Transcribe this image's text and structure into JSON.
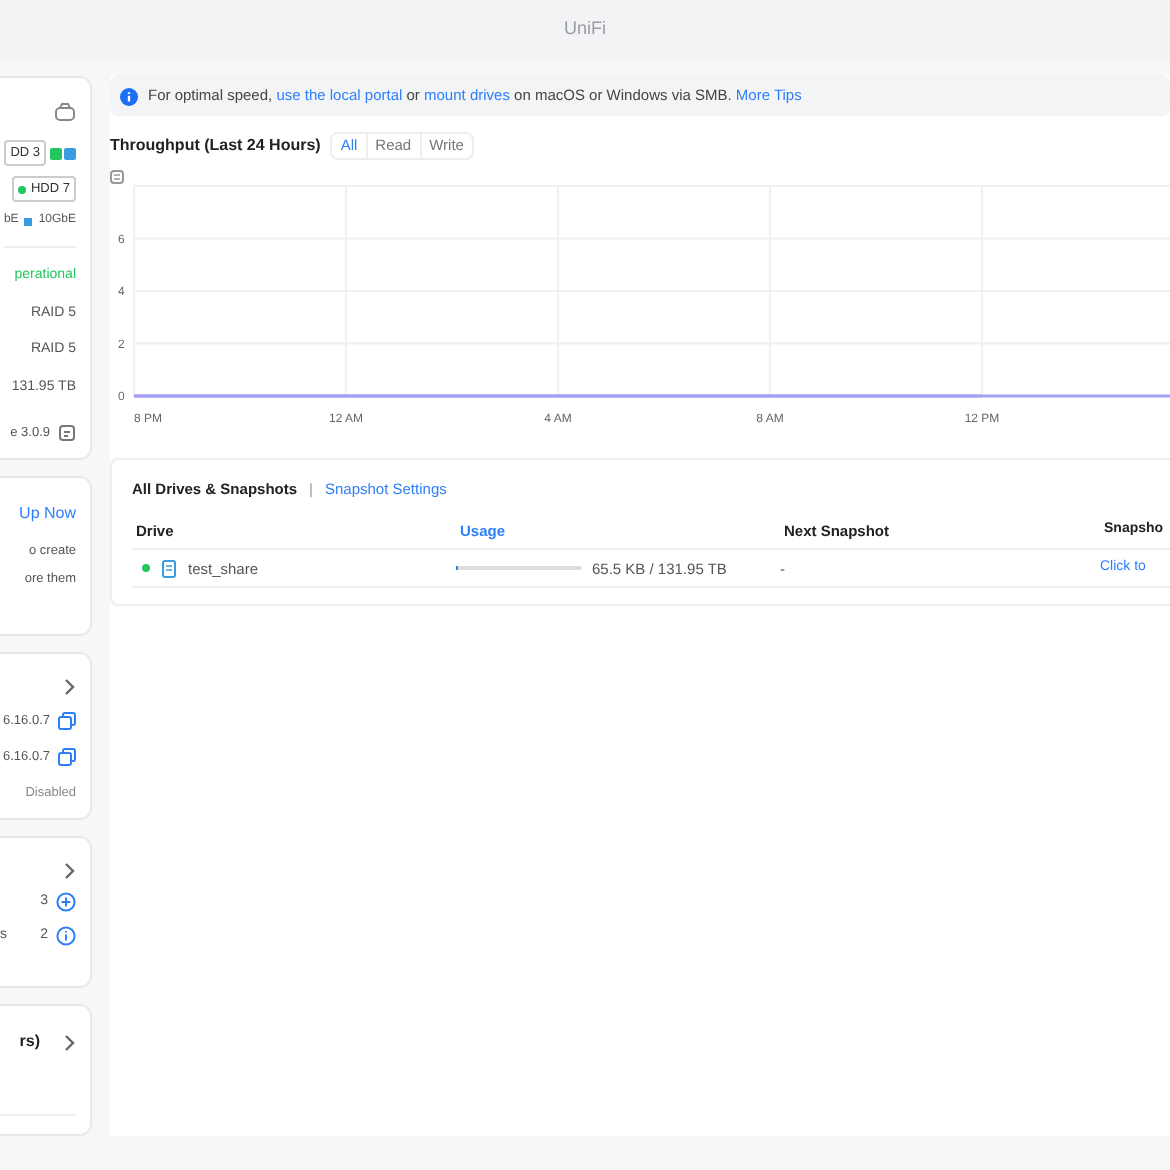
{
  "window": {
    "title": "UniFi"
  },
  "side_cards": [
    {
      "kind": "storage",
      "rows": [
        {
          "kind": "bay",
          "label": "DD 3",
          "dot": false,
          "ports": true
        },
        {
          "kind": "bay",
          "label": "HDD 7",
          "dot": true,
          "ports": false
        },
        {
          "kind": "legend",
          "items": [
            {
              "label": "bE"
            },
            {
              "label": "10GbE",
              "color": "#3b9be0"
            }
          ]
        },
        {
          "kind": "status",
          "text": "perational"
        },
        {
          "kind": "text",
          "text": "RAID 5"
        },
        {
          "kind": "text",
          "text": "RAID 5"
        },
        {
          "kind": "text",
          "text": "131.95 TB"
        },
        {
          "kind": "version",
          "text": "e 3.0.9"
        }
      ]
    },
    {
      "kind": "backup",
      "link": "Up Now",
      "lines": [
        "o create",
        "ore them"
      ]
    },
    {
      "kind": "network",
      "rows": [
        {
          "kind": "address",
          "text": "6.16.0.7"
        },
        {
          "kind": "address",
          "text": "6.16.0.7"
        },
        {
          "kind": "plain",
          "text": "Disabled"
        }
      ]
    },
    {
      "kind": "counts",
      "rows": [
        {
          "kind": "add",
          "label": "",
          "count": "3"
        },
        {
          "kind": "info",
          "label": "s",
          "count": "2"
        }
      ]
    },
    {
      "kind": "titled",
      "title": "rs)"
    }
  ],
  "banner": {
    "text": "For optimal speed, ",
    "link_1": "use the local portal",
    "mid": " or ",
    "link_2": "mount drives",
    "tail": " on macOS or Windows via SMB. ",
    "link_3": "More Tips"
  },
  "throughput": {
    "title": "Throughput (Last 24 Hours)",
    "tabs": [
      {
        "label": "All",
        "selected": true
      },
      {
        "label": "Read",
        "selected": false
      },
      {
        "label": "Write",
        "selected": false
      }
    ],
    "chart_data": {
      "type": "line",
      "categories": [
        "8 PM",
        "12 AM",
        "4 AM",
        "8 AM",
        "12 PM"
      ],
      "series": [
        {
          "color": "#a5a0f5",
          "values": [
            0,
            0,
            0,
            0,
            0
          ]
        }
      ],
      "ylim": [
        0,
        8
      ],
      "yticks": [
        0,
        2,
        4,
        6
      ],
      "grid": true
    }
  },
  "drives": {
    "title": "All Drives & Snapshots",
    "separator": "|",
    "link": "Snapshot Settings",
    "columns": [
      {
        "label": "Drive",
        "sorted": false
      },
      {
        "label": "Usage",
        "sorted": true
      },
      {
        "label": "Next Snapshot",
        "sorted": false
      },
      {
        "label": "Snapsho",
        "sorted": false
      }
    ],
    "rows": [
      {
        "online": true,
        "name": "test_share",
        "level": 0.0,
        "usage": "65.5 KB / 131.95 TB",
        "next": "-",
        "action": "Click to"
      }
    ]
  }
}
